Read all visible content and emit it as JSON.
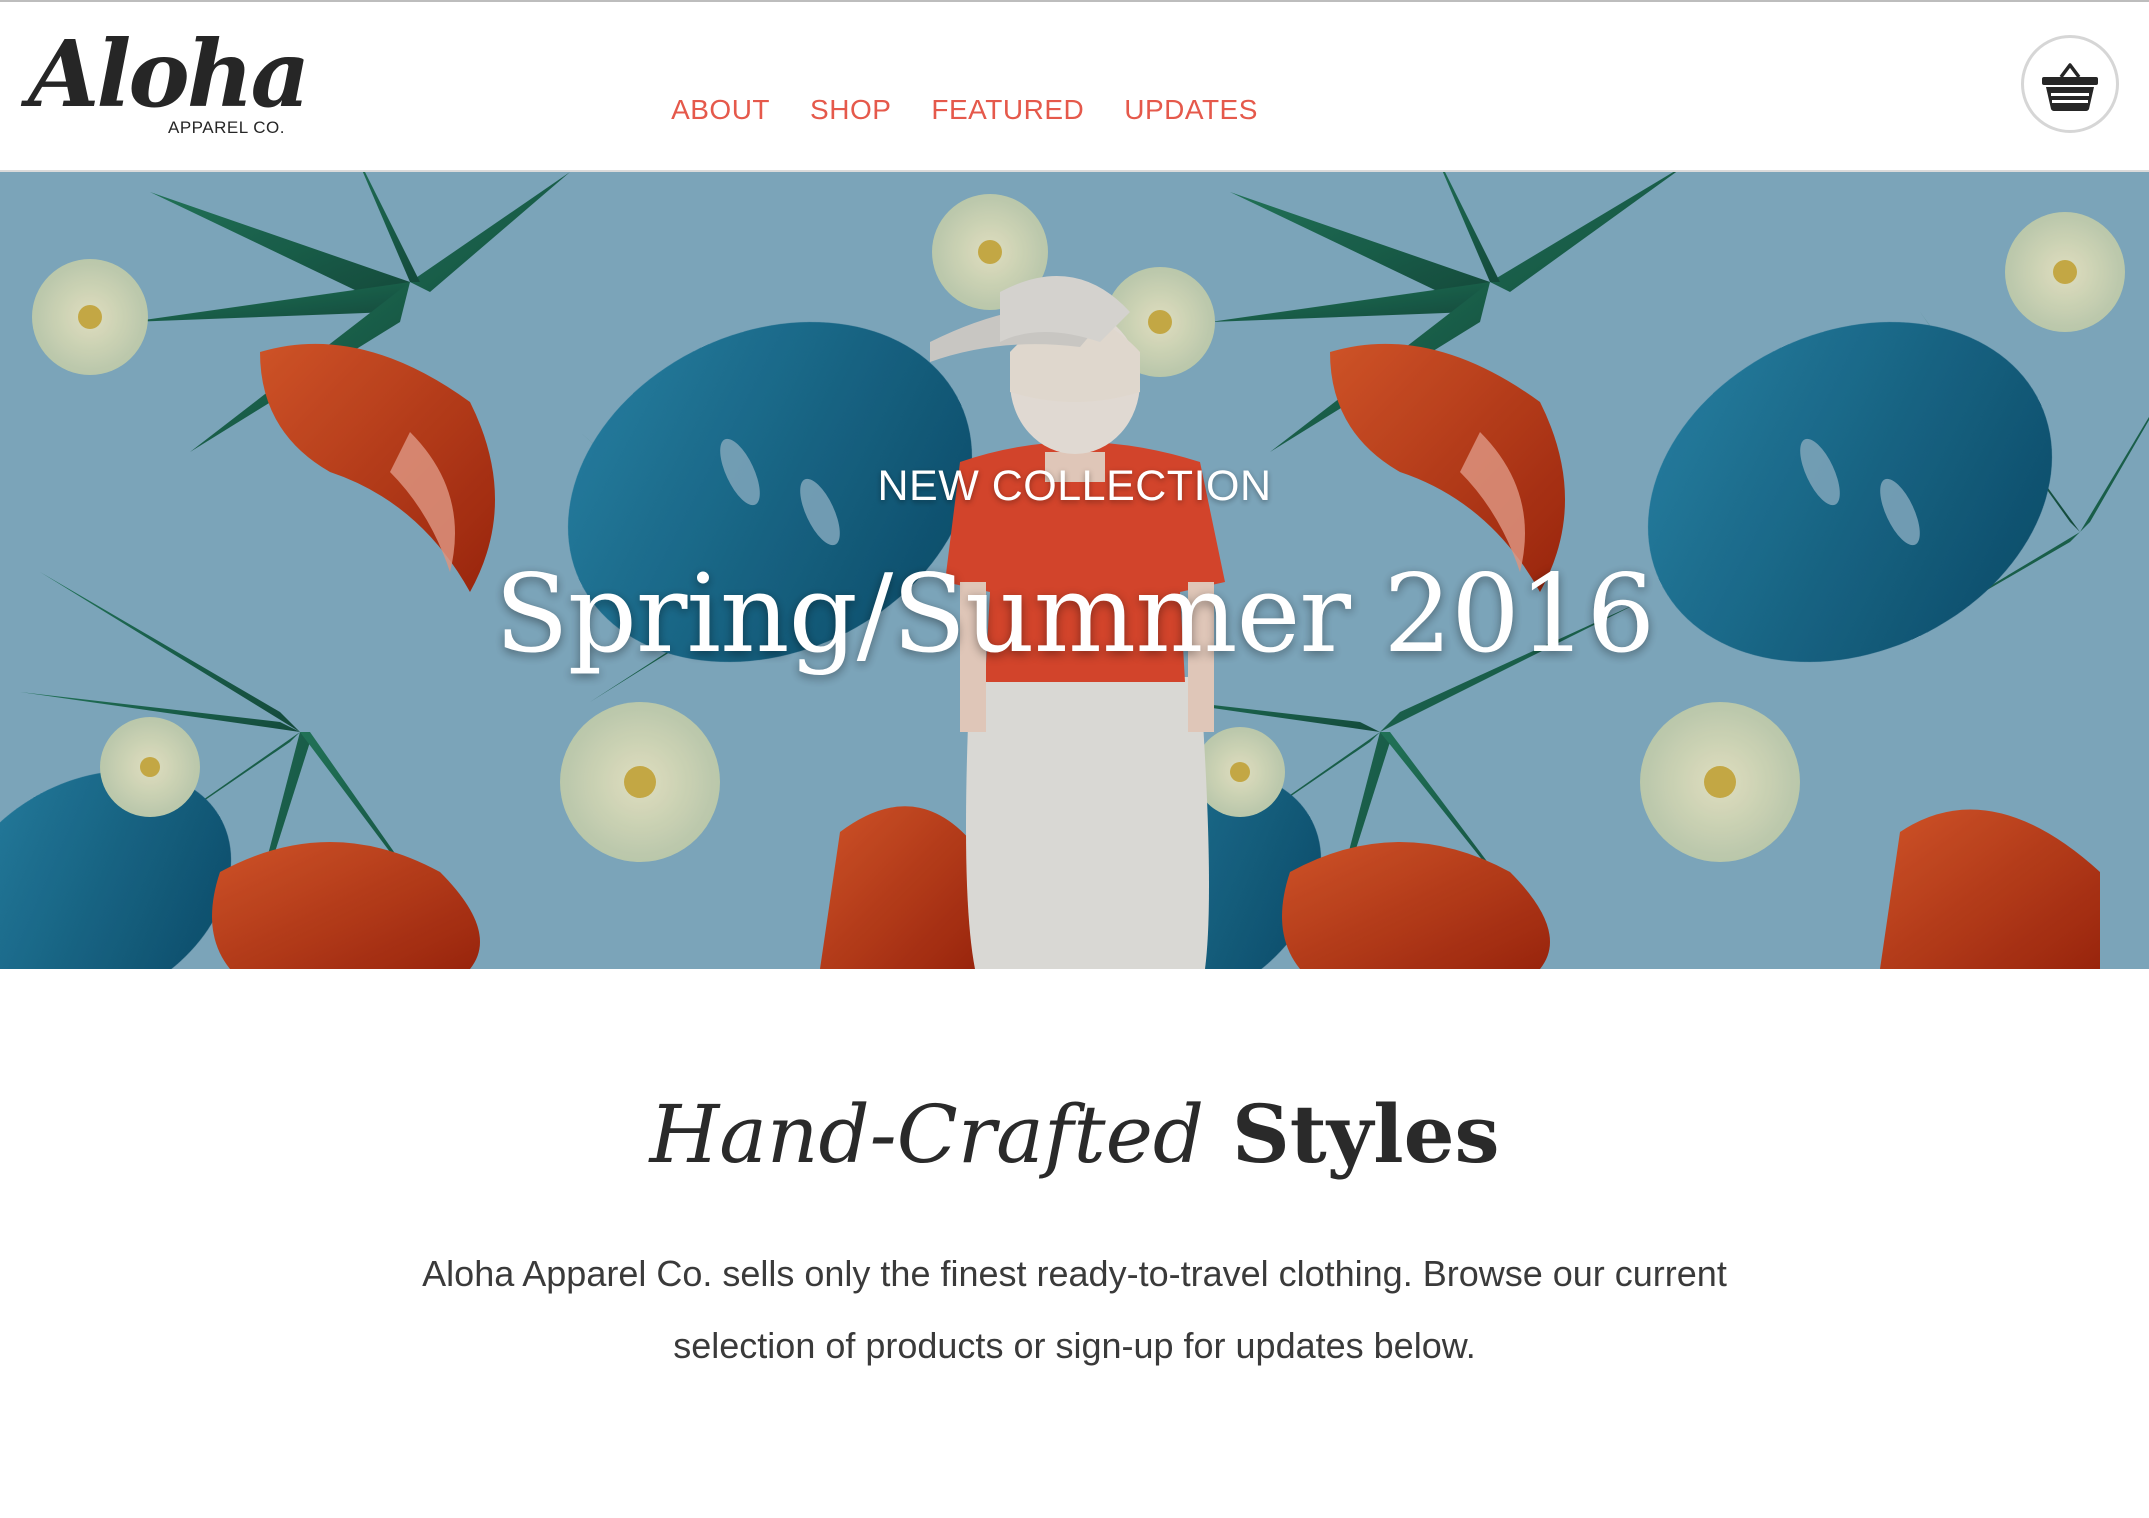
{
  "header": {
    "logo_script": "Aloha",
    "logo_sub": "APPAREL CO.",
    "nav": [
      {
        "label": "ABOUT"
      },
      {
        "label": "SHOP"
      },
      {
        "label": "FEATURED"
      },
      {
        "label": "UPDATES"
      }
    ],
    "cart_icon": "basket-icon"
  },
  "hero": {
    "kicker": "NEW COLLECTION",
    "title": "Spring/Summer 2016"
  },
  "intro": {
    "title_italic": "Hand-Crafted",
    "title_bold": "Styles",
    "body": "Aloha Apparel Co. sells only the finest ready-to-travel clothing. Browse our current selection of products or sign-up for updates below."
  },
  "colors": {
    "accent": "#e5594b",
    "text_dark": "#2a2a2a",
    "hero_sky": "#86b2c9"
  }
}
